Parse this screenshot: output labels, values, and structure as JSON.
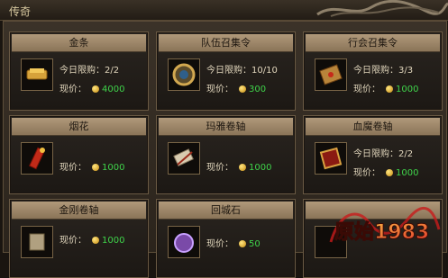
{
  "window": {
    "title": "传奇"
  },
  "labels": {
    "limit_prefix": "今日限购：",
    "price_label": "现价："
  },
  "watermark": {
    "text": "原始1983"
  },
  "items": [
    {
      "name": "金条",
      "limit": "2/2",
      "price": "4000",
      "icon": "gold-bar-icon"
    },
    {
      "name": "队伍召集令",
      "limit": "10/10",
      "price": "300",
      "icon": "summon-medal-icon"
    },
    {
      "name": "行会召集令",
      "limit": "3/3",
      "price": "1000",
      "icon": "guild-token-icon"
    },
    {
      "name": "烟花",
      "limit": "",
      "price": "1000",
      "icon": "firework-icon"
    },
    {
      "name": "玛雅卷轴",
      "limit": "",
      "price": "1000",
      "icon": "scroll-icon"
    },
    {
      "name": "血魔卷轴",
      "limit": "2/2",
      "price": "1000",
      "icon": "blood-scroll-icon"
    },
    {
      "name": "金刚卷轴",
      "limit": "",
      "price": "1000",
      "icon": "diamond-scroll-icon"
    },
    {
      "name": "回城石",
      "limit": "",
      "price": "50",
      "icon": "return-stone-icon"
    },
    {
      "name": "",
      "limit": "",
      "price": "",
      "icon": "unknown-item-icon"
    }
  ]
}
